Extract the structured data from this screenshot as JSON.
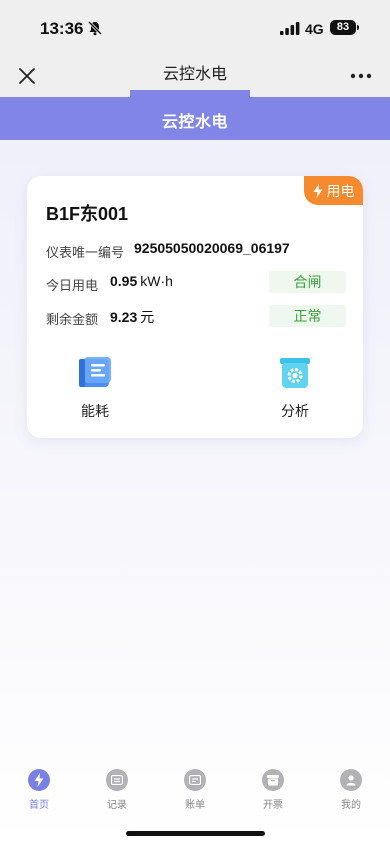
{
  "status_bar": {
    "time": "13:36",
    "network": "4G",
    "battery": "83",
    "icons": [
      "bell-slash-icon",
      "signal-icon",
      "battery-icon"
    ]
  },
  "nav_bar": {
    "title": "云控水电",
    "icons": [
      "close-icon",
      "more-icon"
    ]
  },
  "header": {
    "title": "云控水电",
    "color": "#8085e6"
  },
  "card": {
    "badge": "用电",
    "badge_color": "#f58a2e",
    "badge_icon": "bolt-icon",
    "name": "B1F东001",
    "rows": [
      {
        "label": "仪表唯一编号",
        "value": "92505050020069_06197",
        "unit": ""
      },
      {
        "label": "今日用电",
        "value": "0.95",
        "unit": "kW·h",
        "status": "合闸"
      },
      {
        "label": "剩余金额",
        "value": "9.23",
        "unit": "元",
        "status": "正常"
      }
    ],
    "status_color": "#3aa13a",
    "actions": [
      {
        "label": "能耗",
        "icon": "energy-document-icon"
      },
      {
        "label": "分析",
        "icon": "analysis-gear-icon"
      }
    ]
  },
  "tab_bar": {
    "accent": "#7b80e3",
    "items": [
      {
        "label": "首页",
        "icon": "bolt-icon",
        "active": true
      },
      {
        "label": "记录",
        "icon": "record-icon",
        "active": false
      },
      {
        "label": "账单",
        "icon": "bill-icon",
        "active": false
      },
      {
        "label": "开票",
        "icon": "invoice-box-icon",
        "active": false
      },
      {
        "label": "我的",
        "icon": "user-icon",
        "active": false
      }
    ]
  }
}
